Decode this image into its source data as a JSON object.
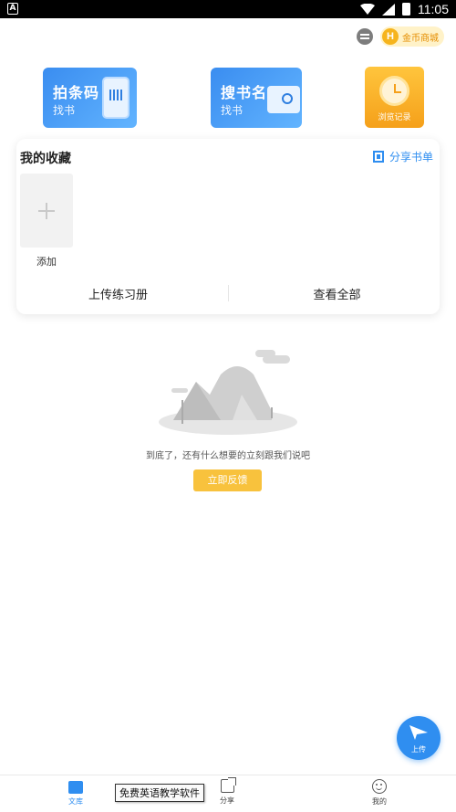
{
  "status_bar": {
    "time": "11:05",
    "left_icon": "A"
  },
  "header": {
    "message_icon": "message-icon",
    "coin_shop": {
      "badge": "H",
      "label": "金币商城"
    }
  },
  "features": {
    "scan": {
      "title": "拍条码",
      "subtitle": "找书"
    },
    "search": {
      "title": "搜书名",
      "subtitle": "找书"
    },
    "history": {
      "label": "浏览记录"
    }
  },
  "favorites": {
    "title": "我的收藏",
    "share_label": "分享书单",
    "add_label": "添加",
    "upload_label": "上传练习册",
    "view_all_label": "查看全部"
  },
  "empty_state": {
    "message": "到底了，还有什么想要的立刻跟我们说吧",
    "feedback_button": "立即反馈"
  },
  "fab": {
    "label": "上传"
  },
  "bottom_nav": {
    "items": [
      {
        "label": "文库"
      },
      {
        "label": "分享"
      },
      {
        "label": "我的"
      }
    ]
  },
  "tooltip": {
    "text": "免费英语教学软件"
  },
  "colors": {
    "accent": "#2f8ef0",
    "yellow": "#f8c23d",
    "coin": "#f6b41d"
  }
}
